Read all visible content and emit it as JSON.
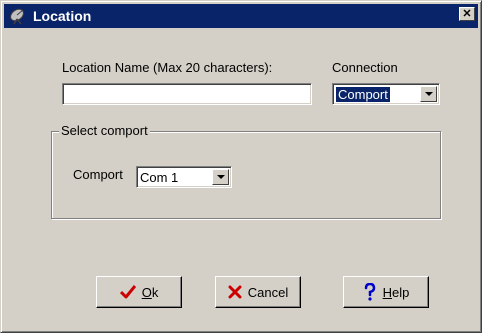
{
  "window": {
    "title": "Location",
    "close_glyph": "✕"
  },
  "form": {
    "location_name_label": "Location Name (Max 20 characters):",
    "location_name_value": "",
    "connection_label": "Connection",
    "connection_value": "Comport"
  },
  "group": {
    "legend": "Select comport",
    "comport_label": "Comport",
    "comport_value": "Com 1"
  },
  "buttons": {
    "ok": {
      "mnemonic": "O",
      "rest": "k"
    },
    "cancel": {
      "label": "Cancel"
    },
    "help": {
      "mnemonic": "H",
      "rest": "elp"
    }
  },
  "icons": {
    "title": "satellite-dish-icon",
    "ok": "checkmark-icon",
    "cancel": "x-icon",
    "help": "question-mark-icon"
  },
  "colors": {
    "titlebar": "#0a246a",
    "dialog_face": "#d4d0c8",
    "ok_icon": "#cc0000",
    "cancel_icon": "#cc0000",
    "help_icon": "#0000cc"
  }
}
